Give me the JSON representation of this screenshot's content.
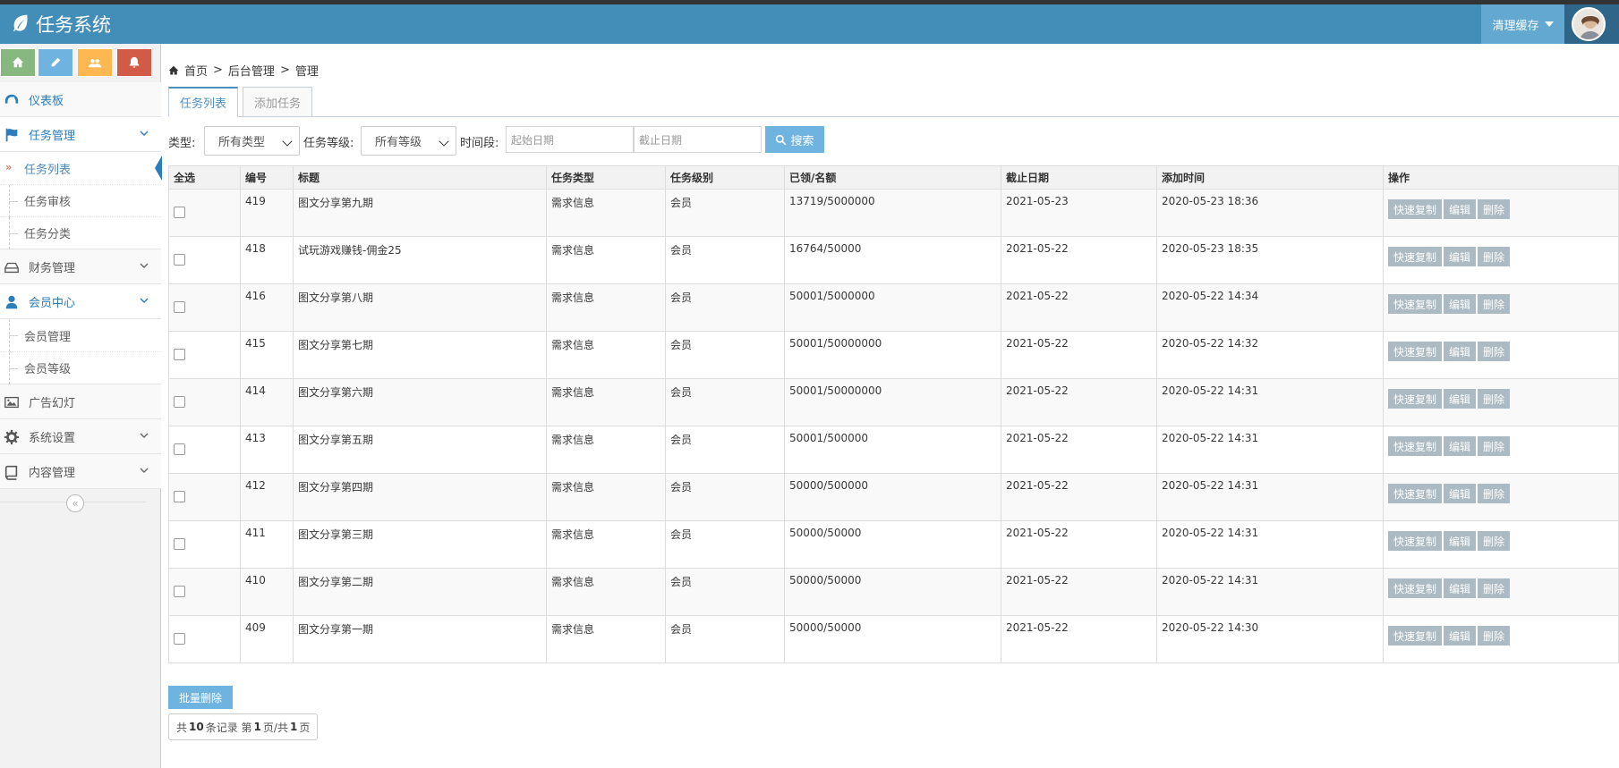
{
  "app": {
    "title": "任务系统"
  },
  "header": {
    "cache_label": "清理缓存"
  },
  "sidebar": {
    "shortcut_colors": [
      "#87b87f",
      "#6fb3e0",
      "#ffb752",
      "#d15b47"
    ],
    "menu": {
      "dashboard": "仪表板",
      "task_mgmt": "任务管理",
      "task_list": "任务列表",
      "task_review": "任务审核",
      "task_category": "任务分类",
      "finance": "财务管理",
      "member_center": "会员中心",
      "member_mgmt": "会员管理",
      "member_level": "会员等级",
      "ads": "广告幻灯",
      "settings": "系统设置",
      "content": "内容管理"
    }
  },
  "breadcrumb": {
    "home": "首页",
    "admin": "后台管理",
    "current": "管理",
    "sep": ">"
  },
  "tabs": {
    "list": "任务列表",
    "add": "添加任务"
  },
  "filters": {
    "type_label": "类型:",
    "type_value": "所有类型",
    "level_label": "任务等级:",
    "level_value": "所有等级",
    "time_label": "时间段:",
    "start_placeholder": "起始日期",
    "end_placeholder": "截止日期",
    "search": "搜索"
  },
  "table": {
    "headers": [
      "全选",
      "编号",
      "标题",
      "任务类型",
      "任务级别",
      "已领/名额",
      "截止日期",
      "添加时间",
      "操作"
    ],
    "ops": [
      "快速复制",
      "编辑",
      "删除"
    ],
    "rows": [
      [
        "419",
        "图文分享第九期",
        "需求信息",
        "会员",
        "13719/5000000",
        "2021-05-23",
        "2020-05-23 18:36"
      ],
      [
        "418",
        "试玩游戏赚钱-佣金25",
        "需求信息",
        "会员",
        "16764/50000",
        "2021-05-22",
        "2020-05-23 18:35"
      ],
      [
        "416",
        "图文分享第八期",
        "需求信息",
        "会员",
        "50001/5000000",
        "2021-05-22",
        "2020-05-22 14:34"
      ],
      [
        "415",
        "图文分享第七期",
        "需求信息",
        "会员",
        "50001/50000000",
        "2021-05-22",
        "2020-05-22 14:32"
      ],
      [
        "414",
        "图文分享第六期",
        "需求信息",
        "会员",
        "50001/50000000",
        "2021-05-22",
        "2020-05-22 14:31"
      ],
      [
        "413",
        "图文分享第五期",
        "需求信息",
        "会员",
        "50001/500000",
        "2021-05-22",
        "2020-05-22 14:31"
      ],
      [
        "412",
        "图文分享第四期",
        "需求信息",
        "会员",
        "50000/500000",
        "2021-05-22",
        "2020-05-22 14:31"
      ],
      [
        "411",
        "图文分享第三期",
        "需求信息",
        "会员",
        "50000/50000",
        "2021-05-22",
        "2020-05-22 14:31"
      ],
      [
        "410",
        "图文分享第二期",
        "需求信息",
        "会员",
        "50000/50000",
        "2021-05-22",
        "2020-05-22 14:31"
      ],
      [
        "409",
        "图文分享第一期",
        "需求信息",
        "会员",
        "50000/50000",
        "2021-05-22",
        "2020-05-22 14:30"
      ]
    ]
  },
  "bulk_delete": "批量删除",
  "pager": {
    "prefix": "共",
    "total": "10",
    "mid1": "条记录 第",
    "page": "1",
    "mid2": "页/共",
    "pages": "1",
    "suffix": "页"
  }
}
